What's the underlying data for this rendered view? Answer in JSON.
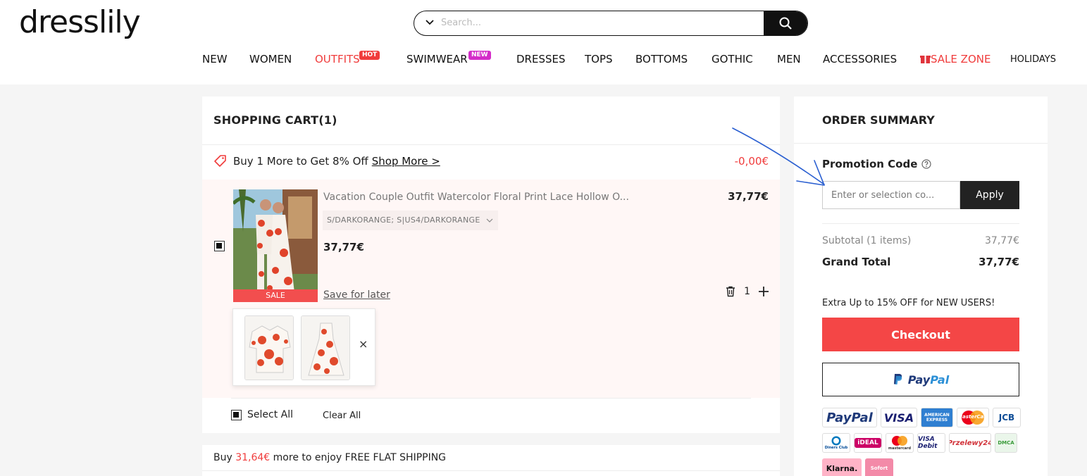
{
  "header": {
    "logo": "dresslily",
    "search_placeholder": "Search...",
    "nav": [
      {
        "label": "NEW"
      },
      {
        "label": "WOMEN"
      },
      {
        "label": "OUTFITS",
        "badge": "HOT"
      },
      {
        "label": "SWIMWEAR",
        "badge": "NEW"
      },
      {
        "label": "DRESSES"
      },
      {
        "label": "TOPS"
      },
      {
        "label": "BOTTOMS"
      },
      {
        "label": "GOTHIC"
      },
      {
        "label": "MEN"
      },
      {
        "label": "ACCESSORIES"
      },
      {
        "label": "SALE ZONE"
      },
      {
        "label": "HOLIDAYS"
      }
    ]
  },
  "cart": {
    "title": "SHOPPING CART(1)",
    "promo_text": "Buy 1 More to Get 8% Off",
    "promo_link": "Shop More >",
    "promo_amount": "-0,00€",
    "item": {
      "name": "Vacation Couple Outfit Watercolor Floral Print Lace Hollow O...",
      "variant": "S/DARKORANGE; S|US4/DARKORANGE",
      "price": "37,77€",
      "price_right": "37,77€",
      "sale_label": "SALE",
      "save_for_later": "Save for later",
      "quantity": "1",
      "bundle_close": "×"
    },
    "select_all": "Select All",
    "clear_all": "Clear All"
  },
  "shipping": {
    "prefix": "Buy",
    "amount": "31,64€",
    "suffix": "more to enjoy FREE FLAT SHIPPING"
  },
  "summary": {
    "title": "ORDER SUMMARY",
    "promo_label": "Promotion Code",
    "promo_placeholder": "Enter or selection co...",
    "apply": "Apply",
    "subtotal_label": "Subtotal (1 items)",
    "subtotal_value": "37,77€",
    "grand_total_label": "Grand Total",
    "grand_total_value": "37,77€",
    "extra_offer": "Extra Up to 15% OFF for NEW USERS!",
    "checkout": "Checkout",
    "paypal_p1": "Pay",
    "paypal_p2": "Pal",
    "payment_methods": [
      {
        "name": "PayPal",
        "label": "PayPal"
      },
      {
        "name": "Visa",
        "label": "VISA"
      },
      {
        "name": "American Express",
        "label": "AMERICAN EXPRESS"
      },
      {
        "name": "Mastercard",
        "label": "MasterCard"
      },
      {
        "name": "JCB",
        "label": "JCB"
      },
      {
        "name": "Diners Club",
        "label": "Diners Club"
      },
      {
        "name": "iDEAL",
        "label": "iDEAL"
      },
      {
        "name": "Maestro",
        "label": "mastercard"
      },
      {
        "name": "Visa Debit",
        "label": "VISA Debit"
      },
      {
        "name": "Przelewy24",
        "label": "Przelewy24"
      },
      {
        "name": "DMCA",
        "label": "DMCA"
      },
      {
        "name": "Klarna",
        "label": "Klarna."
      },
      {
        "name": "Sofort",
        "label": "Sofort"
      }
    ]
  },
  "colors": {
    "accent_red": "#f03c3c",
    "checkout_red": "#f44646",
    "dark": "#222222",
    "annotation_blue": "#2a5fd1"
  }
}
